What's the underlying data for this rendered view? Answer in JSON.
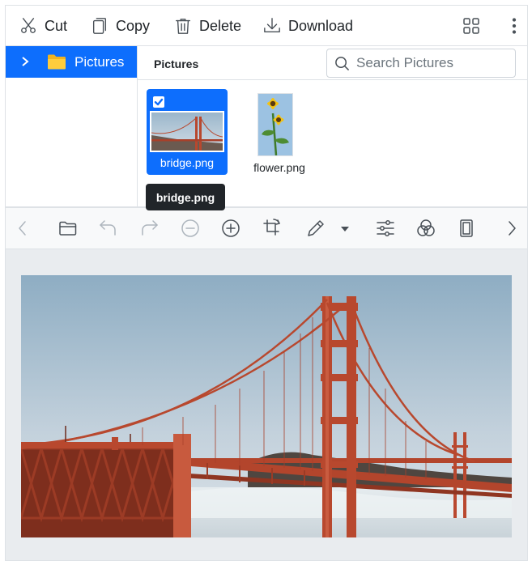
{
  "file_manager": {
    "toolbar": {
      "cut_label": "Cut",
      "copy_label": "Copy",
      "delete_label": "Delete",
      "download_label": "Download"
    },
    "navigation": {
      "items": [
        {
          "label": "Pictures",
          "icon": "folder-icon",
          "selected": true
        }
      ]
    },
    "breadcrumb": {
      "current": "Pictures"
    },
    "search": {
      "placeholder": "Search Pictures",
      "value": ""
    },
    "files": [
      {
        "name": "bridge.png",
        "selected": true
      },
      {
        "name": "flower.png",
        "selected": false
      }
    ],
    "tooltip": "bridge.png"
  },
  "image_editor": {
    "toolbar": {
      "buttons": [
        "chevron-left-icon",
        "open-folder-icon",
        "undo-icon",
        "redo-icon",
        "zoom-out-icon",
        "zoom-in-icon",
        "crop-rotate-icon",
        "pen-icon",
        "dropdown-icon",
        "adjustments-icon",
        "filters-icon",
        "frame-icon",
        "chevron-right-icon"
      ]
    },
    "image": "bridge.png"
  },
  "colors": {
    "accent": "#0d6efd",
    "border": "#dee2e6",
    "canvas_bg": "#e9ecef",
    "tooltip_bg": "#212529"
  }
}
